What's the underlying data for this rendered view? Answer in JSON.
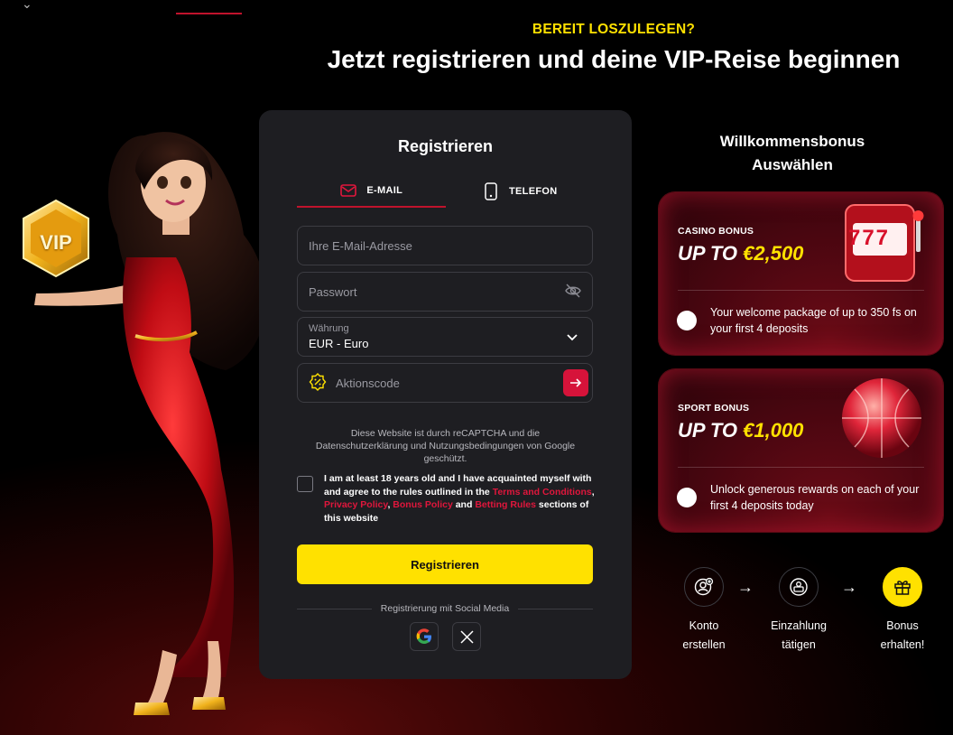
{
  "header": {
    "eyebrow": "BEREIT LOSZULEGEN?",
    "headline": "Jetzt registrieren und deine VIP-Reise beginnen"
  },
  "badge": {
    "text": "VIP"
  },
  "registration": {
    "title": "Registrieren",
    "tabs": [
      {
        "label": "E-MAIL",
        "icon": "mail-icon",
        "active": true
      },
      {
        "label": "TELEFON",
        "icon": "phone-icon",
        "active": false
      }
    ],
    "email_placeholder": "Ihre E-Mail-Adresse",
    "password_placeholder": "Passwort",
    "currency_label": "Währung",
    "currency_value": "EUR - Euro",
    "promo_placeholder": "Aktionscode",
    "recaptcha_text": "Diese Website ist durch reCAPTCHA und die Datenschutzerklärung und Nutzungsbedingungen von Google geschützt.",
    "agree": {
      "prefix": "I am at least 18 years old and I have acquainted myself with and agree to the rules outlined in the ",
      "terms": "Terms and Conditions",
      "sep1": ", ",
      "privacy": "Privacy Policy",
      "sep2": ", ",
      "bonus": "Bonus Policy",
      "and": " and ",
      "betting": "Betting Rules",
      "suffix": " sections of this website"
    },
    "submit_label": "Registrieren",
    "social_label": "Registrierung mit Social Media"
  },
  "bonus": {
    "title_line1": "Willkommensbonus",
    "title_line2": "Auswählen",
    "cards": [
      {
        "label": "CASINO BONUS",
        "amount_prefix": "UP TO ",
        "amount": "€2,500",
        "description": "Your welcome package of up to 350 fs on your first 4 deposits",
        "slot_digits": "777"
      },
      {
        "label": "SPORT BONUS",
        "amount_prefix": "UP TO ",
        "amount": "€1,000",
        "description": "Unlock generous rewards on each of your first 4 deposits today"
      }
    ],
    "steps": [
      {
        "line1": "Konto",
        "line2": "erstellen",
        "icon": "user-add-icon"
      },
      {
        "line1": "Einzahlung",
        "line2": "tätigen",
        "icon": "deposit-icon"
      },
      {
        "line1": "Bonus",
        "line2": "erhalten!",
        "icon": "gift-icon"
      }
    ]
  },
  "colors": {
    "accent_yellow": "#ffe100",
    "accent_red": "#d6133a",
    "card_bg": "#1e1e22"
  }
}
